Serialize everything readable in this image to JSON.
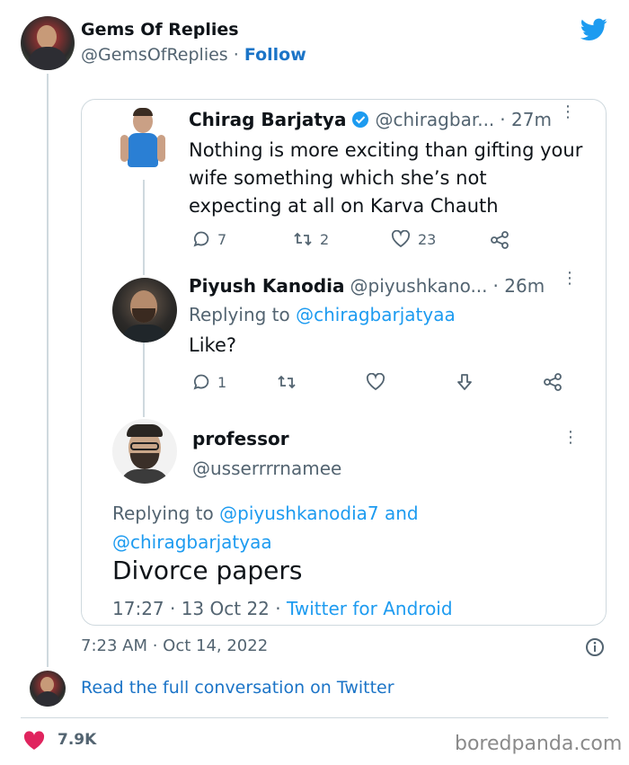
{
  "embed": {
    "author_name": "Gems Of Replies",
    "author_handle": "@GemsOfReplies",
    "dot": "·",
    "follow_label": "Follow",
    "timestamp": "7:23 AM · Oct 14, 2022",
    "read_full_label": "Read the full conversation on Twitter",
    "likes": "7.9K",
    "watermark": "boredpanda.com"
  },
  "thread": {
    "tweets": [
      {
        "name": "Chirag Barjatya",
        "handle": "@chiragbar...",
        "time": "· 27m",
        "text_lines": [
          "Nothing is more exciting than gifting your",
          "wife something which she’s not",
          "expecting at all on Karva Chauth"
        ],
        "replies": "7",
        "retweets": "2",
        "likes": "23"
      },
      {
        "name": "Piyush Kanodia",
        "handle": "@piyushkano...",
        "time": "· 26m",
        "replying_prefix": "Replying to",
        "replying_to": "@chiragbarjatyaa",
        "text": "Like?",
        "replies": "1"
      },
      {
        "name": "professor",
        "handle": "@usserrrrnamee",
        "replying_prefix": "Replying to",
        "replying_to_1": "@piyushkanodia7 and",
        "replying_to_2": "@chiragbarjatyaa",
        "text": "Divorce papers",
        "time": "17:27 · 13 Oct 22 ·",
        "source": "Twitter for Android"
      }
    ]
  },
  "colors": {
    "twitter_blue": "#1d9bf0",
    "link_blue": "#1b74c7",
    "heart_pink": "#e0245e",
    "border": "#cfd9de",
    "muted": "#536471"
  }
}
